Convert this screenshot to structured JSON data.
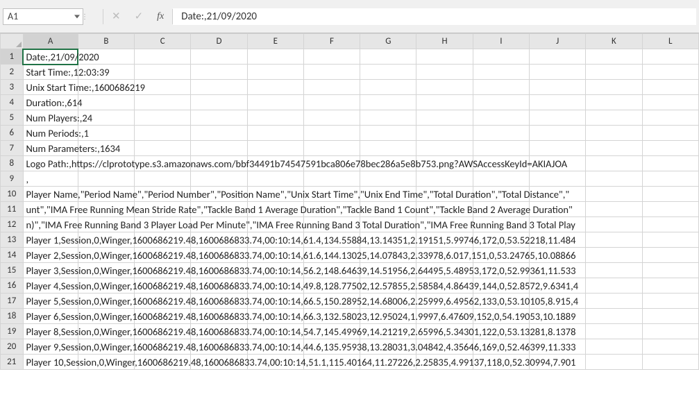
{
  "nameBox": {
    "value": "A1"
  },
  "formulaBar": {
    "cancel_label": "✕",
    "confirm_label": "✓",
    "fx_label": "fx",
    "value": "Date:,21/09/2020"
  },
  "columns": [
    "A",
    "B",
    "C",
    "D",
    "E",
    "F",
    "G",
    "H",
    "I",
    "J",
    "K",
    "L"
  ],
  "rows": [
    {
      "num": "1",
      "text": "Date:,21/09/2020"
    },
    {
      "num": "2",
      "text": "Start Time:,12:03:39"
    },
    {
      "num": "3",
      "text": "Unix Start Time:,1600686219"
    },
    {
      "num": "4",
      "text": "Duration:,614"
    },
    {
      "num": "5",
      "text": "Num Players:,24"
    },
    {
      "num": "6",
      "text": "Num Periods:,1"
    },
    {
      "num": "7",
      "text": "Num Parameters:,1634"
    },
    {
      "num": "8",
      "text": "Logo Path:,https://clprototype.s3.amazonaws.com/bbf34491b74547591bca806e78bec286a5e8b753.png?AWSAccessKeyId=AKIAJOA"
    },
    {
      "num": "9",
      "text": ","
    },
    {
      "num": "10",
      "text": "Player Name,\"Period Name\",\"Period Number\",\"Position Name\",\"Unix Start Time\",\"Unix End Time\",\"Total Duration\",\"Total Distance\",\""
    },
    {
      "num": "11",
      "text": "unt\",\"IMA Free Running Mean Stride Rate\",\"Tackle Band 1 Average Duration\",\"Tackle Band 1 Count\",\"Tackle Band 2 Average Duration\""
    },
    {
      "num": "12",
      "text": "n)\",\"IMA Free Running Band 3 Player Load Per Minute\",\"IMA Free Running Band 3 Total Duration\",\"IMA Free Running Band 3 Total Play"
    },
    {
      "num": "13",
      "text": "Player 1,Session,0,Winger,1600686219.48,1600686833.74,00:10:14,61.4,134.55884,13.14351,2.19151,5.99746,172,0,53.52218,11.484"
    },
    {
      "num": "14",
      "text": "Player 2,Session,0,Winger,1600686219.48,1600686833.74,00:10:14,61.6,144.13025,14.07843,2.33978,6.017,151,0,53.24765,10.08866"
    },
    {
      "num": "15",
      "text": "Player 3,Session,0,Winger,1600686219.48,1600686833.74,00:10:14,56.2,148.64639,14.51956,2.64495,5.48953,172,0,52.99361,11.533"
    },
    {
      "num": "16",
      "text": "Player 4,Session,0,Winger,1600686219.48,1600686833.74,00:10:14,49.8,128.77502,12.57855,2.58584,4.86439,144,0,52.8572,9.6341,4"
    },
    {
      "num": "17",
      "text": "Player 5,Session,0,Winger,1600686219.48,1600686833.74,00:10:14,66.5,150.28952,14.68006,2.25999,6.49562,133,0,53.10105,8.915,4"
    },
    {
      "num": "18",
      "text": "Player 6,Session,0,Winger,1600686219.48,1600686833.74,00:10:14,66.3,132.58023,12.95024,1.9997,6.47609,152,0,54.19053,10.1889"
    },
    {
      "num": "19",
      "text": "Player 8,Session,0,Winger,1600686219.48,1600686833.74,00:10:14,54.7,145.49969,14.21219,2.65996,5.34301,122,0,53.13281,8.1378"
    },
    {
      "num": "20",
      "text": "Player 9,Session,0,Winger,1600686219.48,1600686833.74,00:10:14,44.6,135.95938,13.28031,3.04842,4.35646,169,0,52.46399,11.333"
    },
    {
      "num": "21",
      "text": "Player 10,Session,0,Winger,1600686219.48,1600686833.74,00:10:14,51.1,115.40164,11.27226,2.25835,4.99137,118,0,52.30994,7.901"
    }
  ],
  "colWidths": {
    "rowHead": 32,
    "A": 78,
    "rest": 80
  },
  "activeCell": {
    "row": 1,
    "col": "A"
  }
}
